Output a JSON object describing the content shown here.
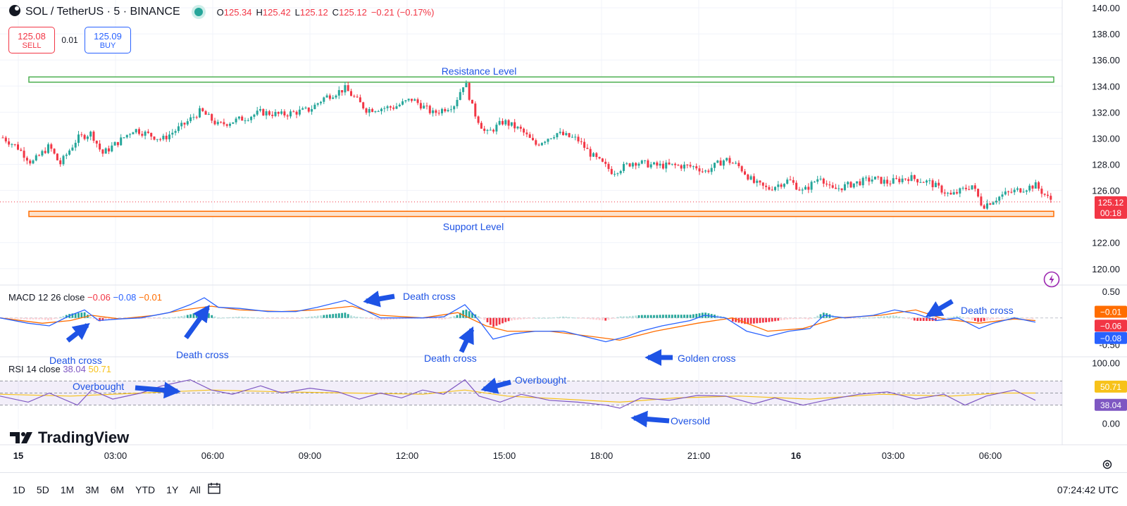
{
  "header": {
    "symbol": "SOL / TetherUS · 5 · BINANCE",
    "ohlc": [
      {
        "k": "O",
        "v": "125.34"
      },
      {
        "k": "H",
        "v": "125.42"
      },
      {
        "k": "L",
        "v": "125.12"
      },
      {
        "k": "C",
        "v": "125.12"
      },
      {
        "k": "",
        "v": "−0.21 (−0.17%)"
      }
    ]
  },
  "trade": {
    "sell_price": "125.08",
    "sell_label": "SELL",
    "spread": "0.01",
    "buy_price": "125.09",
    "buy_label": "BUY"
  },
  "logo_text": "TradingView",
  "time_labels": [
    "15",
    "03:00",
    "06:00",
    "09:00",
    "12:00",
    "15:00",
    "18:00",
    "21:00",
    "16",
    "03:00",
    "06:00"
  ],
  "ranges": [
    "1D",
    "5D",
    "1M",
    "3M",
    "6M",
    "YTD",
    "1Y",
    "All"
  ],
  "clock": "07:24:42 UTC",
  "colors": {
    "up": "#26a69a",
    "down": "#f23645",
    "macd": "#2962ff",
    "signal": "#ff6d00",
    "rsi": "#7e57c2",
    "rsi_ma": "#f7c21a",
    "resistance": "#4caf50",
    "support": "#ff6d00",
    "annotation": "#1e53e5"
  },
  "chart_data": [
    {
      "type": "candlestick",
      "title": "SOL / TetherUS · 5 · BINANCE",
      "ylim": [
        118.8,
        140.6
      ],
      "yticks": [
        "140.00",
        "138.00",
        "136.00",
        "134.00",
        "132.00",
        "130.00",
        "128.00",
        "126.00",
        "122.00",
        "120.00"
      ],
      "last_price_label": "125.12",
      "countdown_label": "00:18",
      "levels": [
        {
          "name": "Resistance Level",
          "from": 134.3,
          "to": 134.7
        },
        {
          "name": "Support Level",
          "from": 124.0,
          "to": 124.4
        }
      ],
      "price_path": [
        [
          0,
          130.2
        ],
        [
          25,
          129.3
        ],
        [
          45,
          128.1
        ],
        [
          70,
          129.4
        ],
        [
          85,
          128.0
        ],
        [
          110,
          130.0
        ],
        [
          130,
          130.4
        ],
        [
          145,
          128.8
        ],
        [
          170,
          129.8
        ],
        [
          190,
          130.7
        ],
        [
          230,
          129.9
        ],
        [
          260,
          131.0
        ],
        [
          285,
          132.1
        ],
        [
          310,
          131.0
        ],
        [
          350,
          131.6
        ],
        [
          370,
          132.0
        ],
        [
          400,
          131.8
        ],
        [
          440,
          132.2
        ],
        [
          460,
          133.1
        ],
        [
          490,
          133.8
        ],
        [
          520,
          132.2
        ],
        [
          560,
          132.4
        ],
        [
          585,
          133.0
        ],
        [
          615,
          131.9
        ],
        [
          645,
          132.6
        ],
        [
          660,
          134.4
        ],
        [
          672,
          132.1
        ],
        [
          690,
          130.3
        ],
        [
          715,
          131.3
        ],
        [
          740,
          130.6
        ],
        [
          760,
          129.5
        ],
        [
          790,
          130.4
        ],
        [
          820,
          129.9
        ],
        [
          840,
          128.7
        ],
        [
          870,
          127.4
        ],
        [
          900,
          128.2
        ],
        [
          930,
          127.9
        ],
        [
          960,
          127.9
        ],
        [
          990,
          127.8
        ],
        [
          1000,
          127.4
        ],
        [
          1030,
          128.4
        ],
        [
          1050,
          127.8
        ],
        [
          1070,
          126.6
        ],
        [
          1090,
          126.1
        ],
        [
          1120,
          126.8
        ],
        [
          1140,
          125.9
        ],
        [
          1165,
          127.1
        ],
        [
          1180,
          126.0
        ],
        [
          1210,
          126.5
        ],
        [
          1240,
          126.9
        ],
        [
          1260,
          126.6
        ],
        [
          1290,
          127.0
        ],
        [
          1320,
          126.6
        ],
        [
          1350,
          125.6
        ],
        [
          1380,
          126.4
        ],
        [
          1395,
          124.8
        ],
        [
          1425,
          125.7
        ],
        [
          1450,
          126.1
        ],
        [
          1470,
          126.4
        ],
        [
          1490,
          125.3
        ]
      ]
    },
    {
      "type": "line",
      "title": "MACD 12 26 close",
      "legend_values": [
        {
          "v": "−0.06",
          "c": "#f23645"
        },
        {
          "v": "−0.08",
          "c": "#2962ff"
        },
        {
          "v": "−0.01",
          "c": "#ff6d00"
        }
      ],
      "ylim": [
        -0.72,
        0.62
      ],
      "yticks": [
        "0.50",
        "-0.50"
      ],
      "axis_badges": [
        "−0.01",
        "−0.06",
        "−0.08"
      ],
      "series": [
        {
          "name": "MACD",
          "values": [
            [
              0,
              0.0
            ],
            [
              40,
              -0.1
            ],
            [
              70,
              -0.15
            ],
            [
              100,
              0.05
            ],
            [
              120,
              0.15
            ],
            [
              140,
              -0.05
            ],
            [
              170,
              -0.02
            ],
            [
              200,
              0.0
            ],
            [
              240,
              0.1
            ],
            [
              270,
              0.25
            ],
            [
              290,
              0.38
            ],
            [
              310,
              0.2
            ],
            [
              340,
              0.18
            ],
            [
              380,
              0.12
            ],
            [
              420,
              0.12
            ],
            [
              450,
              0.2
            ],
            [
              490,
              0.33
            ],
            [
              510,
              0.2
            ],
            [
              540,
              0.0
            ],
            [
              570,
              0.0
            ],
            [
              600,
              0.0
            ],
            [
              630,
              0.02
            ],
            [
              660,
              0.25
            ],
            [
              680,
              -0.05
            ],
            [
              700,
              -0.4
            ],
            [
              730,
              -0.3
            ],
            [
              760,
              -0.25
            ],
            [
              800,
              -0.25
            ],
            [
              830,
              -0.35
            ],
            [
              860,
              -0.45
            ],
            [
              890,
              -0.35
            ],
            [
              910,
              -0.25
            ],
            [
              940,
              -0.15
            ],
            [
              980,
              -0.05
            ],
            [
              1000,
              0.05
            ],
            [
              1030,
              0.0
            ],
            [
              1060,
              -0.25
            ],
            [
              1090,
              -0.35
            ],
            [
              1120,
              -0.25
            ],
            [
              1150,
              -0.2
            ],
            [
              1170,
              0.05
            ],
            [
              1200,
              0.0
            ],
            [
              1240,
              0.05
            ],
            [
              1270,
              0.15
            ],
            [
              1300,
              0.08
            ],
            [
              1330,
              -0.05
            ],
            [
              1360,
              0.0
            ],
            [
              1390,
              -0.2
            ],
            [
              1410,
              -0.1
            ],
            [
              1440,
              0.0
            ],
            [
              1470,
              -0.08
            ]
          ]
        },
        {
          "name": "Signal",
          "values": [
            [
              0,
              0.0
            ],
            [
              60,
              -0.1
            ],
            [
              100,
              -0.05
            ],
            [
              130,
              0.05
            ],
            [
              170,
              -0.02
            ],
            [
              220,
              0.05
            ],
            [
              260,
              0.15
            ],
            [
              300,
              0.22
            ],
            [
              340,
              0.15
            ],
            [
              400,
              0.12
            ],
            [
              450,
              0.15
            ],
            [
              500,
              0.22
            ],
            [
              540,
              0.05
            ],
            [
              600,
              0.0
            ],
            [
              650,
              0.1
            ],
            [
              690,
              -0.15
            ],
            [
              720,
              -0.25
            ],
            [
              780,
              -0.25
            ],
            [
              840,
              -0.35
            ],
            [
              880,
              -0.42
            ],
            [
              930,
              -0.25
            ],
            [
              990,
              -0.1
            ],
            [
              1040,
              0.0
            ],
            [
              1090,
              -0.25
            ],
            [
              1140,
              -0.2
            ],
            [
              1190,
              0.0
            ],
            [
              1250,
              0.05
            ],
            [
              1300,
              0.15
            ],
            [
              1340,
              -0.02
            ],
            [
              1390,
              -0.1
            ],
            [
              1440,
              -0.02
            ],
            [
              1470,
              -0.05
            ]
          ]
        }
      ]
    },
    {
      "type": "line",
      "title": "RSI 14 close",
      "legend_values": [
        {
          "v": "38.04",
          "c": "#7e57c2"
        },
        {
          "v": "50.71",
          "c": "#f7c21a"
        }
      ],
      "ylim": [
        0,
        100
      ],
      "yticks": [
        "100.00",
        "0.00"
      ],
      "band": [
        30,
        70
      ],
      "axis_badges": [
        "50.71",
        "38.04"
      ],
      "series": [
        {
          "name": "RSI",
          "values": [
            [
              0,
              45
            ],
            [
              40,
              35
            ],
            [
              70,
              50
            ],
            [
              110,
              30
            ],
            [
              130,
              55
            ],
            [
              160,
              40
            ],
            [
              200,
              50
            ],
            [
              230,
              62
            ],
            [
              270,
              72
            ],
            [
              300,
              55
            ],
            [
              330,
              48
            ],
            [
              370,
              62
            ],
            [
              400,
              50
            ],
            [
              440,
              58
            ],
            [
              480,
              52
            ],
            [
              510,
              40
            ],
            [
              540,
              50
            ],
            [
              570,
              42
            ],
            [
              600,
              55
            ],
            [
              630,
              48
            ],
            [
              660,
              72
            ],
            [
              680,
              45
            ],
            [
              710,
              35
            ],
            [
              740,
              48
            ],
            [
              780,
              38
            ],
            [
              820,
              35
            ],
            [
              860,
              30
            ],
            [
              880,
              25
            ],
            [
              910,
              42
            ],
            [
              950,
              38
            ],
            [
              990,
              46
            ],
            [
              1030,
              45
            ],
            [
              1070,
              32
            ],
            [
              1100,
              42
            ],
            [
              1140,
              30
            ],
            [
              1180,
              40
            ],
            [
              1220,
              48
            ],
            [
              1260,
              52
            ],
            [
              1300,
              40
            ],
            [
              1340,
              48
            ],
            [
              1370,
              30
            ],
            [
              1400,
              45
            ],
            [
              1440,
              55
            ],
            [
              1470,
              38
            ]
          ]
        },
        {
          "name": "RSI-based MA",
          "values": [
            [
              0,
              48
            ],
            [
              100,
              45
            ],
            [
              200,
              50
            ],
            [
              300,
              55
            ],
            [
              400,
              52
            ],
            [
              500,
              50
            ],
            [
              600,
              48
            ],
            [
              660,
              55
            ],
            [
              720,
              45
            ],
            [
              800,
              40
            ],
            [
              880,
              35
            ],
            [
              960,
              42
            ],
            [
              1050,
              45
            ],
            [
              1150,
              40
            ],
            [
              1250,
              48
            ],
            [
              1350,
              45
            ],
            [
              1420,
              50
            ],
            [
              1470,
              50
            ]
          ]
        }
      ]
    }
  ],
  "annotations": [
    {
      "text": "Resistance Level",
      "color": "#1e53e5"
    },
    {
      "text": "Support Level",
      "color": "#1e53e5"
    },
    {
      "text": "Death cross",
      "color": "#1e53e5"
    },
    {
      "text": "Death cross",
      "color": "#1e53e5"
    },
    {
      "text": "Death cross",
      "color": "#1e53e5"
    },
    {
      "text": "Death cross",
      "color": "#1e53e5"
    },
    {
      "text": "Golden cross",
      "color": "#1e53e5"
    },
    {
      "text": "Death cross",
      "color": "#1e53e5"
    },
    {
      "text": "Overbought",
      "color": "#1e53e5"
    },
    {
      "text": "Overbought",
      "color": "#1e53e5"
    },
    {
      "text": "Oversold",
      "color": "#1e53e5"
    }
  ]
}
